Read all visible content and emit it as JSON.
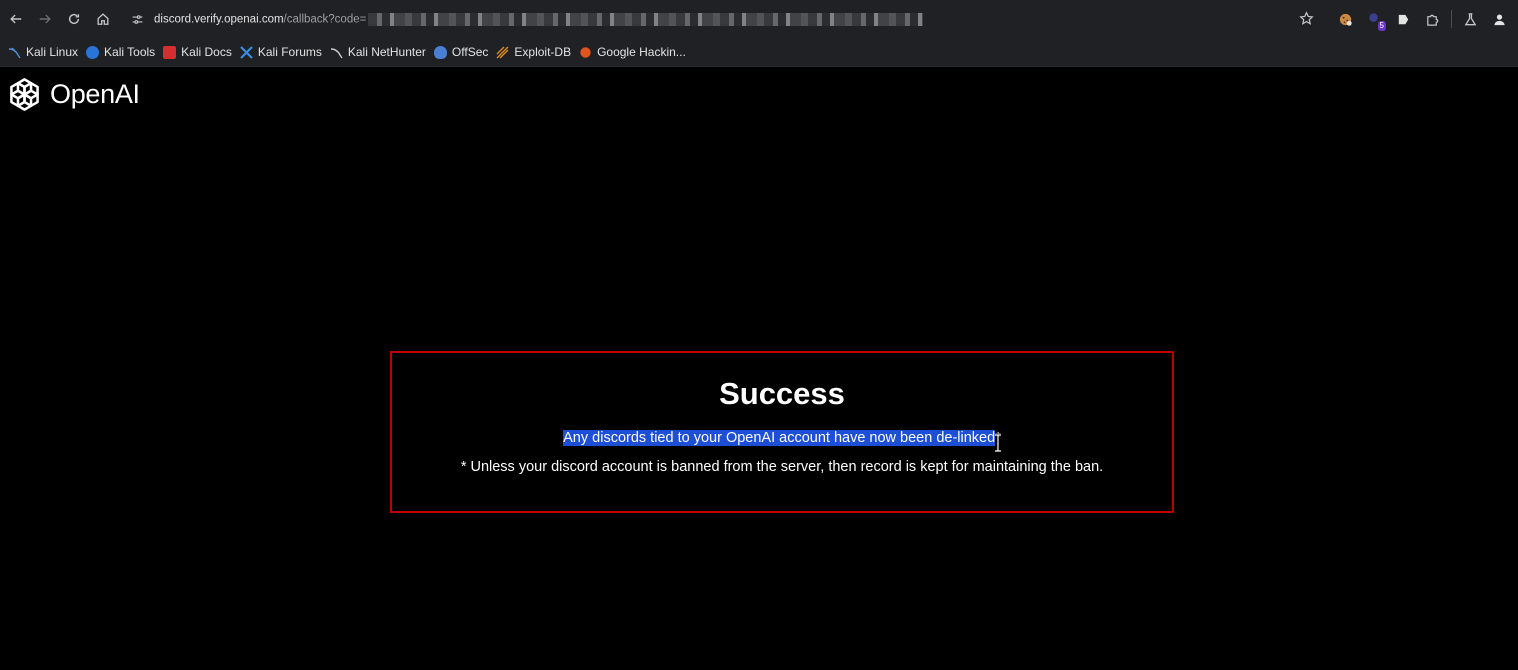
{
  "browser": {
    "url_host": "discord.verify.openai.com",
    "url_path": "/callback?code=",
    "extension_badge": "5"
  },
  "bookmarks": [
    {
      "label": "Kali Linux",
      "icon": "kali-dragon-icon",
      "color": "#4f8fd6"
    },
    {
      "label": "Kali Tools",
      "icon": "kali-tools-icon",
      "color": "#2a74d8"
    },
    {
      "label": "Kali Docs",
      "icon": "kali-docs-icon",
      "color": "#d42e2e"
    },
    {
      "label": "Kali Forums",
      "icon": "kali-forums-icon",
      "color": "#3c8de0"
    },
    {
      "label": "Kali NetHunter",
      "icon": "kali-nethunter-icon",
      "color": "#9aa0a6"
    },
    {
      "label": "OffSec",
      "icon": "offsec-icon",
      "color": "#4a7fd4"
    },
    {
      "label": "Exploit-DB",
      "icon": "exploit-db-icon",
      "color": "#e08a1e"
    },
    {
      "label": "Google Hackin...",
      "icon": "google-hacking-icon",
      "color": "#e0551e"
    }
  ],
  "page": {
    "logo_text": "OpenAI",
    "card": {
      "title": "Success",
      "message_selected": "Any discords tied to your OpenAI account have now been de-linked",
      "message_suffix": "*",
      "note": "* Unless your discord account is banned from the server, then record is kept for maintaining the ban."
    }
  },
  "colors": {
    "accent_border": "#c00000",
    "selection": "#1c4fd6",
    "background": "#000000"
  }
}
